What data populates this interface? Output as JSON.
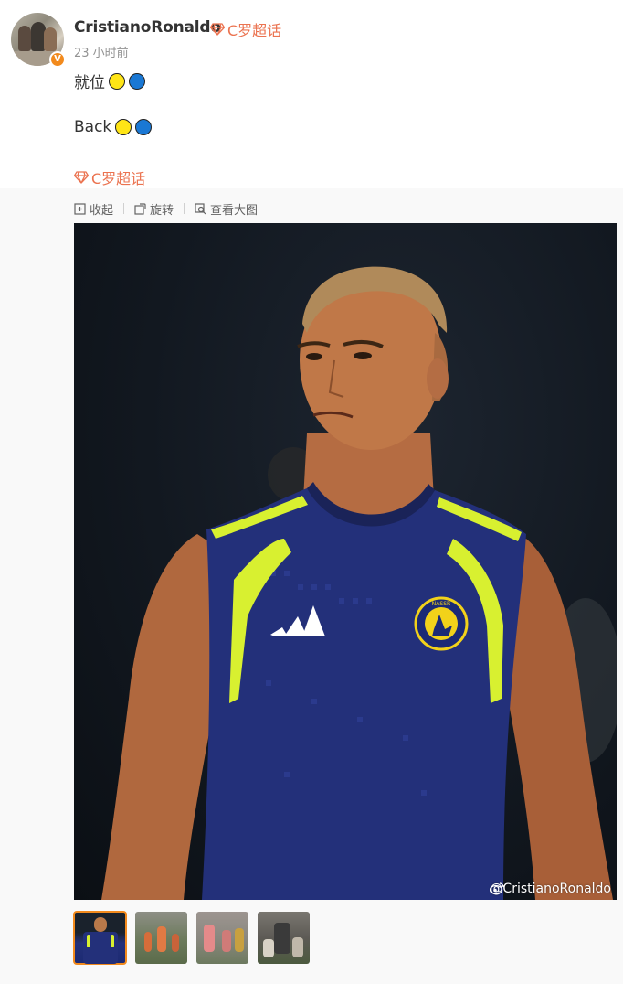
{
  "post": {
    "username": "CristianoRonaldo",
    "supertopic_label": "C罗超话",
    "timestamp": "23 小时前",
    "verified_mark": "V",
    "lines": [
      {
        "text": "就位",
        "dots": [
          "yellow",
          "blue"
        ]
      },
      {
        "text": "Back",
        "dots": [
          "yellow",
          "blue"
        ]
      }
    ],
    "topic_link": "C罗超话"
  },
  "media": {
    "toolbar": {
      "collapse_label": "收起",
      "rotate_label": "旋转",
      "view_large_label": "查看大图"
    },
    "watermark": "@CristianoRonaldo",
    "badge_text": "NASSR",
    "thumbnail_count": 4,
    "active_thumbnail": 1
  },
  "colors": {
    "accent": "#eb7350",
    "badge": "#f28a1d",
    "jersey": "#23307a",
    "jersey_trim": "#d8f030",
    "dot_yellow": "#ffe516",
    "dot_blue": "#1a78d4"
  }
}
